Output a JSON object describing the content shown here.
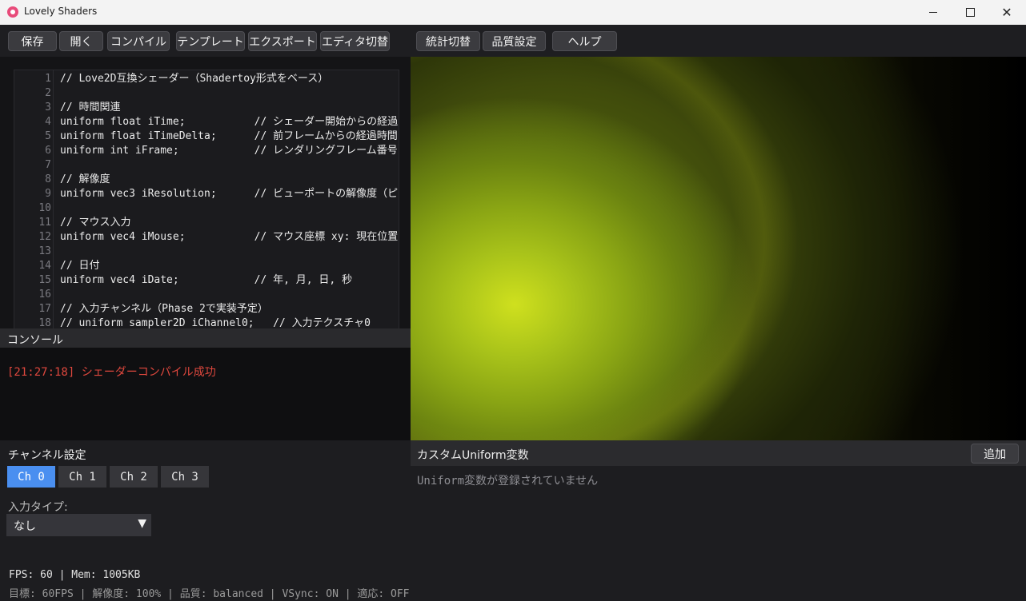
{
  "window": {
    "title": "Lovely Shaders"
  },
  "toolbar": {
    "save": "保存",
    "open": "開く",
    "compile": "コンパイル",
    "template": "テンプレート",
    "export": "エクスポート",
    "editor_toggle": "エディタ切替",
    "stats_toggle": "統計切替",
    "quality": "品質設定",
    "help": "ヘルプ"
  },
  "editor": {
    "lines": [
      {
        "n": "1",
        "t": "// Love2D互換シェーダー（Shadertoy形式をベース）"
      },
      {
        "n": "2",
        "t": ""
      },
      {
        "n": "3",
        "t": "// 時間関連"
      },
      {
        "n": "4",
        "t": "uniform float iTime;           // シェーダー開始からの経過"
      },
      {
        "n": "5",
        "t": "uniform float iTimeDelta;      // 前フレームからの経過時間"
      },
      {
        "n": "6",
        "t": "uniform int iFrame;            // レンダリングフレーム番号"
      },
      {
        "n": "7",
        "t": ""
      },
      {
        "n": "8",
        "t": "// 解像度"
      },
      {
        "n": "9",
        "t": "uniform vec3 iResolution;      // ビューポートの解像度（ピ"
      },
      {
        "n": "10",
        "t": ""
      },
      {
        "n": "11",
        "t": "// マウス入力"
      },
      {
        "n": "12",
        "t": "uniform vec4 iMouse;           // マウス座標 xy: 現在位置"
      },
      {
        "n": "13",
        "t": ""
      },
      {
        "n": "14",
        "t": "// 日付"
      },
      {
        "n": "15",
        "t": "uniform vec4 iDate;            // 年, 月, 日, 秒"
      },
      {
        "n": "16",
        "t": ""
      },
      {
        "n": "17",
        "t": "// 入力チャンネル（Phase 2で実装予定）"
      },
      {
        "n": "18",
        "t": "// uniform sampler2D iChannel0;   // 入力テクスチャ0"
      }
    ]
  },
  "console": {
    "title": "コンソール",
    "message": "[21:27:18] シェーダーコンパイル成功"
  },
  "channels": {
    "title": "チャンネル設定",
    "tabs": [
      "Ch 0",
      "Ch 1",
      "Ch 2",
      "Ch 3"
    ],
    "input_type_label": "入力タイプ:",
    "input_type_value": "なし"
  },
  "status": {
    "line1": "FPS: 60 | Mem: 1005KB",
    "line2": "目標: 60FPS | 解像度: 100% | 品質: balanced | VSync: ON | 適応: OFF"
  },
  "uniforms": {
    "title": "カスタムUniform変数",
    "add": "追加",
    "empty": "Uniform変数が登録されていません"
  }
}
